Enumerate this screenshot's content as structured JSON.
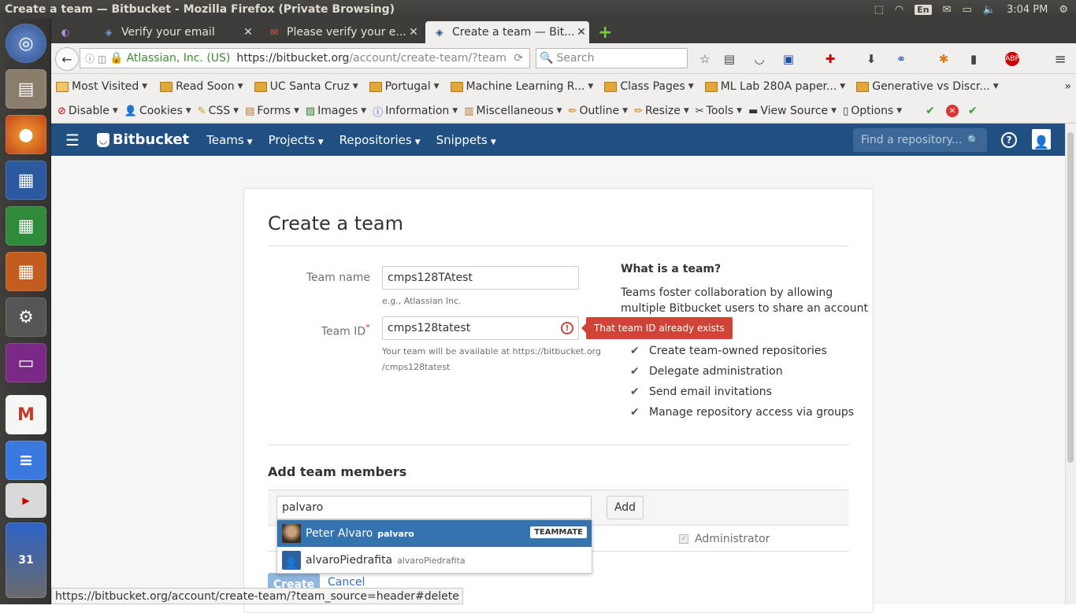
{
  "window_title": "Create a team — Bitbucket - Mozilla Firefox (Private Browsing)",
  "panel": {
    "lang": "En",
    "time": "3:04 PM"
  },
  "tabs": [
    {
      "label": "Verify your email"
    },
    {
      "label": "Please verify your e..."
    },
    {
      "label": "Create a team — Bit..."
    }
  ],
  "address": {
    "org": "Atlassian, Inc. (US)",
    "url_host": "https://bitbucket.org",
    "url_path": "/account/create-team/?team"
  },
  "search_placeholder": "Search",
  "bookmarks": [
    "Most Visited",
    "Read Soon",
    "UC Santa Cruz",
    "Portugal",
    "Machine Learning R...",
    "Class Pages",
    "ML Lab 280A paper...",
    "Generative vs Discr..."
  ],
  "devtools": [
    "Disable",
    "Cookies",
    "CSS",
    "Forms",
    "Images",
    "Information",
    "Miscellaneous",
    "Outline",
    "Resize",
    "Tools",
    "View Source",
    "Options"
  ],
  "bb": {
    "logo": "Bitbucket",
    "nav": [
      "Teams",
      "Projects",
      "Repositories",
      "Snippets"
    ],
    "search_placeholder": "Find a repository..."
  },
  "form": {
    "heading": "Create a team",
    "team_name_label": "Team name",
    "team_name_value": "cmps128TAtest",
    "team_name_help": "e.g., Atlassian Inc.",
    "team_id_label": "Team ID",
    "team_id_value": "cmps128tatest",
    "team_id_help1": "Your team will be available at https://bitbucket.org",
    "team_id_help2": "/cmps128tatest",
    "error": "That team ID already exists",
    "side_title": "What is a team?",
    "side_text1": "Teams foster collaboration by allowing",
    "side_text2": "multiple Bitbucket users to share an account",
    "features": [
      "Create team-owned repositories",
      "Delegate administration",
      "Send email invitations",
      "Manage repository access via groups"
    ],
    "add_title": "Add team members",
    "member_input": "palvaro",
    "add_button": "Add",
    "administrator": "Administrator",
    "create": "Create",
    "cancel": "Cancel"
  },
  "suggestions": [
    {
      "name": "Peter Alvaro",
      "user": "palvaro",
      "badge": "TEAMMATE"
    },
    {
      "name": "alvaroPiedrafita",
      "user": "alvaroPiedrafita"
    }
  ],
  "status_url": "https://bitbucket.org/account/create-team/?team_source=header#delete"
}
